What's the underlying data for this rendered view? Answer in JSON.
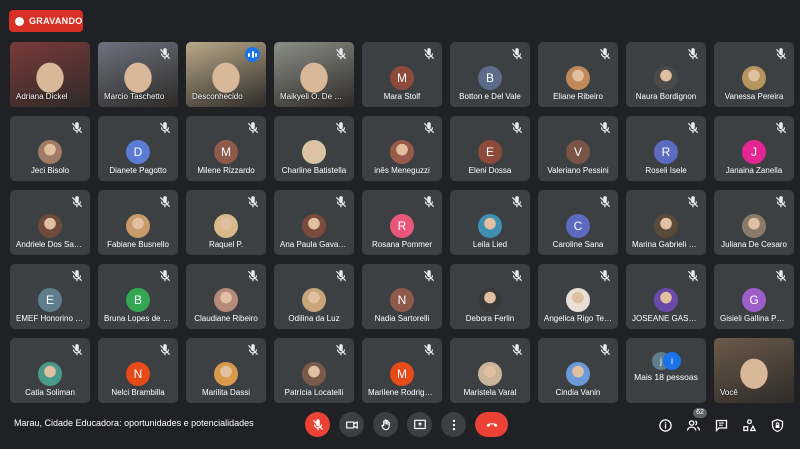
{
  "recording": {
    "label": "GRAVANDO",
    "color": "#d93025"
  },
  "meeting": {
    "title": "Marau, Cidade Educadora: oportunidades e potencialidades"
  },
  "people_count": "62",
  "participants": [
    {
      "name": "Adriana Dickel",
      "kind": "video",
      "muted": false,
      "scene": "#7a3a3a"
    },
    {
      "name": "Marcio Taschetto",
      "kind": "video",
      "muted": true,
      "scene": "#6d7280"
    },
    {
      "name": "Desconhecido",
      "kind": "video",
      "muted": false,
      "speaking": true,
      "scene": "#b9a98a"
    },
    {
      "name": "Maikyeli O. De Gasperi",
      "kind": "video",
      "muted": true,
      "scene": "#8b8f86"
    },
    {
      "name": "Mara Stolf",
      "kind": "initial",
      "initial": "M",
      "color": "#8d4a3b",
      "muted": true
    },
    {
      "name": "Botton e Del Vale",
      "kind": "initial",
      "initial": "B",
      "color": "#5c6b8a",
      "muted": true
    },
    {
      "name": "Eliane Ribeiro",
      "kind": "photo",
      "color": "#c08a5a",
      "muted": true
    },
    {
      "name": "Naura Bordignon",
      "kind": "photo",
      "color": "#4a4a4a",
      "muted": true
    },
    {
      "name": "Vanessa Pereira",
      "kind": "photo",
      "color": "#b6955e",
      "muted": true
    },
    {
      "name": "Jeci Bisolo",
      "kind": "photo",
      "color": "#a07b65",
      "muted": true
    },
    {
      "name": "Dianete Pagotto",
      "kind": "initial",
      "initial": "D",
      "color": "#5b7bd5",
      "muted": true
    },
    {
      "name": "Milene Rizzardo",
      "kind": "initial",
      "initial": "M",
      "color": "#8d5a4b",
      "muted": true
    },
    {
      "name": "Charline Batistella",
      "kind": "photo",
      "color": "#d9c3a5",
      "muted": true
    },
    {
      "name": "inês Meneguzzi",
      "kind": "photo",
      "color": "#9a5a4a",
      "muted": true
    },
    {
      "name": "Eleni Dossa",
      "kind": "initial",
      "initial": "E",
      "color": "#8d4a3b",
      "muted": true
    },
    {
      "name": "Valeriano Pessini",
      "kind": "initial",
      "initial": "V",
      "color": "#795548",
      "muted": true
    },
    {
      "name": "Roseli Isele",
      "kind": "initial",
      "initial": "R",
      "color": "#5c6bc0",
      "muted": true
    },
    {
      "name": "Janaina Zanella",
      "kind": "initial",
      "initial": "J",
      "color": "#e52592",
      "muted": true
    },
    {
      "name": "Andriele Dos Santos",
      "kind": "photo",
      "color": "#6d4a3a",
      "muted": true
    },
    {
      "name": "Fabiane Busnello",
      "kind": "photo",
      "color": "#c99a6a",
      "muted": true
    },
    {
      "name": "Raquel P.",
      "kind": "photo",
      "color": "#d7b98a",
      "muted": true
    },
    {
      "name": "Ana Paula Gavazzoni",
      "kind": "photo",
      "color": "#7a4a3a",
      "muted": true
    },
    {
      "name": "Rosana Pommer",
      "kind": "initial",
      "initial": "R",
      "color": "#e8577a",
      "muted": true
    },
    {
      "name": "Leila Lied",
      "kind": "photo",
      "color": "#3f8fb0",
      "muted": true
    },
    {
      "name": "Caroline Sana",
      "kind": "initial",
      "initial": "C",
      "color": "#5c6bc0",
      "muted": true
    },
    {
      "name": "Marina Gabrieli Galina",
      "kind": "photo",
      "color": "#5a4a3a",
      "muted": true
    },
    {
      "name": "Juliana De Cesaro",
      "kind": "photo",
      "color": "#8a7a6a",
      "muted": true
    },
    {
      "name": "EMEF Honorino Sartori",
      "kind": "initial",
      "initial": "E",
      "color": "#607d8b",
      "muted": true
    },
    {
      "name": "Bruna Lopes de Oliveira",
      "kind": "initial",
      "initial": "B",
      "color": "#33a852",
      "muted": true
    },
    {
      "name": "Claudiane Ribeiro",
      "kind": "photo",
      "color": "#b58a7a",
      "muted": true
    },
    {
      "name": "Odilina da Luz",
      "kind": "photo",
      "color": "#c9a67a",
      "muted": true
    },
    {
      "name": "Nadia Sartorelli",
      "kind": "initial",
      "initial": "N",
      "color": "#8d5a4b",
      "muted": true
    },
    {
      "name": "Debora Ferlin",
      "kind": "photo",
      "color": "#3a3a3a",
      "muted": true
    },
    {
      "name": "Angelica Rigo Tesser",
      "kind": "photo",
      "color": "#e8e0d8",
      "muted": true
    },
    {
      "name": "JOSEANE GASPARETTO",
      "kind": "photo",
      "color": "#6a4aa8",
      "muted": true
    },
    {
      "name": "Gisieli Gallina Pelicioli",
      "kind": "initial",
      "initial": "G",
      "color": "#9c5fc9",
      "muted": true
    },
    {
      "name": "Catia Soliman",
      "kind": "photo",
      "color": "#4a9a8a",
      "muted": true
    },
    {
      "name": "Nelci Brambilla",
      "kind": "initial",
      "initial": "N",
      "color": "#e64a19",
      "muted": true
    },
    {
      "name": "Marilita Dassi",
      "kind": "photo",
      "color": "#d89a4a",
      "muted": true
    },
    {
      "name": "Patrícia Locatelli",
      "kind": "photo",
      "color": "#7a5a4a",
      "muted": true
    },
    {
      "name": "Marilene Rodrigues",
      "kind": "initial",
      "initial": "M",
      "color": "#e64a19",
      "muted": true
    },
    {
      "name": "Maristela Varal",
      "kind": "photo",
      "color": "#c9b49a",
      "muted": true
    },
    {
      "name": "Cindia Vanin",
      "kind": "photo",
      "color": "#6a9ad8",
      "muted": true
    },
    {
      "name": "Mais 18 pessoas",
      "kind": "more",
      "avatars": [
        {
          "initial": "j",
          "color": "#607d8b"
        },
        {
          "initial": "i",
          "color": "#1a73e8"
        }
      ]
    },
    {
      "name": "Você",
      "kind": "video",
      "muted": false,
      "self": true,
      "scene": "#6b5a4a"
    }
  ]
}
